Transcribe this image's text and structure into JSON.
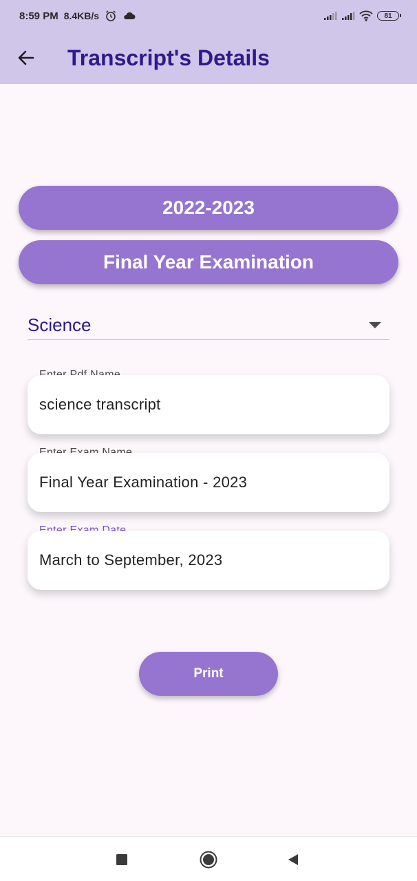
{
  "status_bar": {
    "time": "8:59 PM",
    "speed": "8.4KB/s",
    "battery": "81",
    "icons": [
      "alarm-icon",
      "cloud-icon",
      "signal-icon",
      "signal-icon",
      "wifi-icon",
      "battery-icon"
    ]
  },
  "app_bar": {
    "title": "Transcript's Details",
    "back_icon": "arrow-left-icon"
  },
  "buttons": {
    "year": "2022-2023",
    "exam": "Final Year Examination",
    "print": "Print"
  },
  "dropdown": {
    "selected": "Science"
  },
  "fields": {
    "pdf_name": {
      "label": "Enter Pdf Name",
      "value": "science transcript"
    },
    "exam_name": {
      "label": "Enter Exam Name",
      "value": "Final Year Examination - 2023"
    },
    "exam_date": {
      "label": "Enter Exam Date",
      "value": "March to September, 2023"
    }
  },
  "nav_bar": {
    "icons": [
      "square-icon",
      "circle-icon",
      "triangle-back-icon"
    ]
  },
  "colors": {
    "header": "#d0c6ea",
    "accent": "#9675d0",
    "title": "#2d1a8c",
    "background": "#fdf7fc"
  }
}
